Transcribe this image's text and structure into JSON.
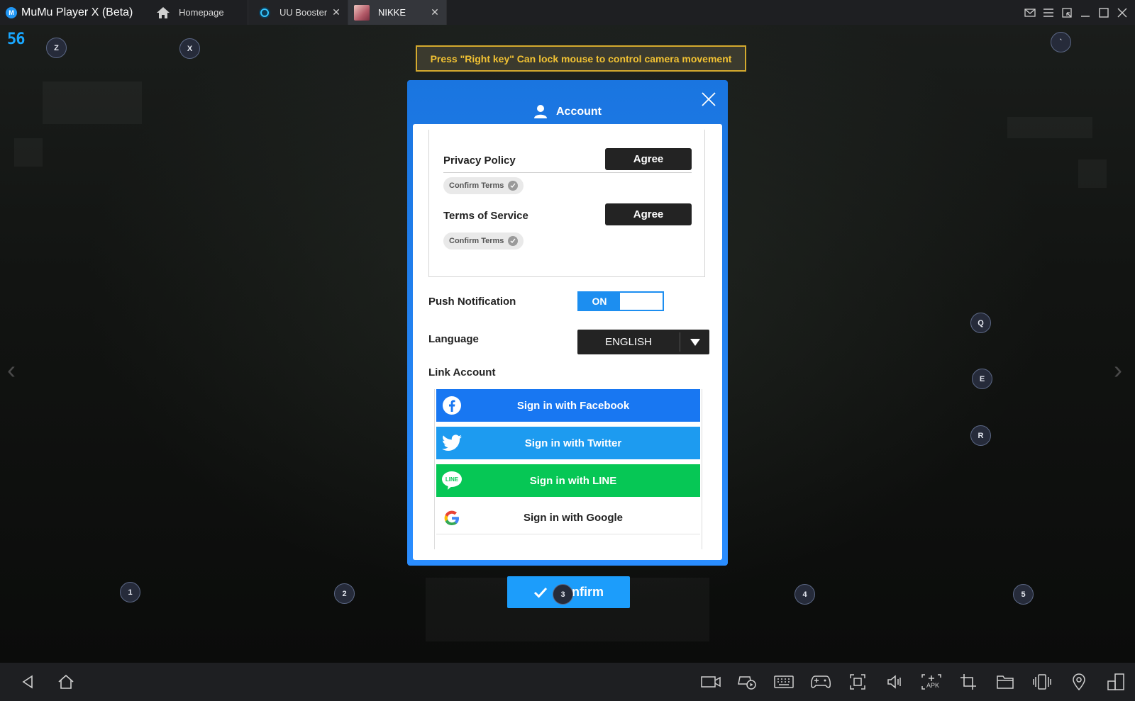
{
  "app": {
    "title": "MuMu Player X  (Beta)"
  },
  "tabs": [
    {
      "label": "Homepage"
    },
    {
      "label": "UU Booster"
    },
    {
      "label": "NIKKE"
    }
  ],
  "overlay": {
    "fps": "56",
    "tooltip": "Press \"Right key\" Can lock mouse to control camera movement",
    "keys": [
      "Z",
      "X",
      "`",
      "Q",
      "E",
      "R",
      "1",
      "2",
      "3",
      "4",
      "5"
    ]
  },
  "dialog": {
    "title": "Account",
    "privacy": {
      "label": "Privacy Policy",
      "agree": "Agree",
      "confirm": "Confirm Terms"
    },
    "terms": {
      "label": "Terms of Service",
      "agree": "Agree",
      "confirm": "Confirm Terms"
    },
    "push": {
      "label": "Push Notification",
      "state": "ON"
    },
    "language": {
      "label": "Language",
      "value": "ENGLISH"
    },
    "link": {
      "label": "Link Account",
      "facebook": "Sign in with Facebook",
      "twitter": "Sign in with Twitter",
      "line": "Sign in with LINE",
      "google": "Sign in with Google"
    }
  },
  "confirm_button": "Confirm",
  "colors": {
    "accent": "#1c9dfb",
    "facebook": "#1877f2",
    "twitter": "#1d9bf0",
    "line": "#06c755",
    "tooltip_border": "#d4aa2e"
  },
  "icons": {
    "bottom_left": [
      "back-icon",
      "home-icon"
    ],
    "bottom_tools": [
      "video-record-icon",
      "gamepad-record-icon",
      "keyboard-icon",
      "gamepad-icon",
      "screenshot-icon",
      "volume-icon",
      "apk-install-icon",
      "crop-icon",
      "folder-icon",
      "shake-icon",
      "location-icon",
      "multi-window-icon"
    ]
  }
}
